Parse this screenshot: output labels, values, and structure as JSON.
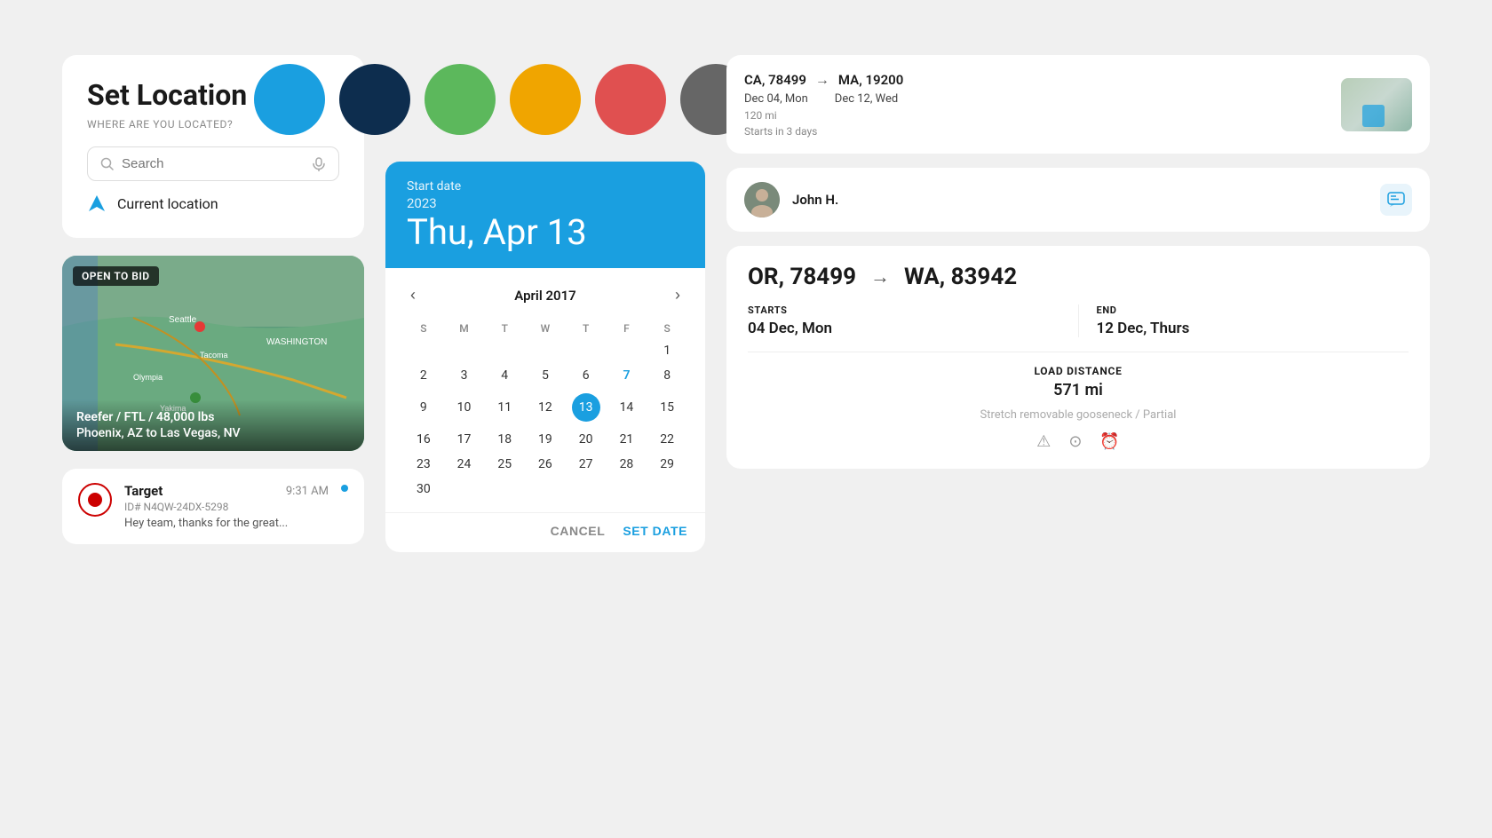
{
  "colors": {
    "blue": "#1a9fe0",
    "dark_navy": "#0d2d4e",
    "green": "#5cb85c",
    "yellow": "#f0a500",
    "red": "#e05050",
    "dark_gray": "#666666",
    "light_gray": "#c0c0c0"
  },
  "set_location": {
    "title": "Set Location",
    "subtitle": "WHERE ARE YOU LOCATED?",
    "search_placeholder": "Search",
    "current_location_label": "Current location"
  },
  "map_card": {
    "badge": "OPEN TO BID",
    "info_line1": "Reefer / FTL / 48,000 lbs",
    "info_line2": "Phoenix, AZ to Las Vegas, NV"
  },
  "notification": {
    "name": "Target",
    "id": "ID# N4QW-24DX-5298",
    "time": "9:31 AM",
    "message": "Hey team, thanks for the great..."
  },
  "calendar": {
    "start_label": "Start date",
    "year": "2023",
    "selected_date": "Thu, Apr 13",
    "month_label": "April 2017",
    "days_of_week": [
      "S",
      "M",
      "T",
      "W",
      "T",
      "F",
      "S"
    ],
    "weeks": [
      [
        "",
        "",
        "",
        "",
        "",
        "",
        "1"
      ],
      [
        "2",
        "3",
        "4",
        "5",
        "6",
        "7",
        "8"
      ],
      [
        "9",
        "10",
        "11",
        "12",
        "13",
        "14",
        "15"
      ],
      [
        "16",
        "17",
        "18",
        "19",
        "20",
        "21",
        "22"
      ],
      [
        "23",
        "24",
        "25",
        "26",
        "27",
        "28",
        "29"
      ],
      [
        "30",
        "",
        "",
        "",
        "",
        "",
        ""
      ]
    ],
    "today_day": "13",
    "highlight_day": "7",
    "cancel_label": "CANCEL",
    "set_date_label": "SET DATE"
  },
  "route_top": {
    "from": "CA, 78499",
    "to": "MA, 19200",
    "from_date": "Dec 04, Mon",
    "to_date": "Dec 12, Wed",
    "distance": "120 mi",
    "starts_in": "Starts in 3 days"
  },
  "user": {
    "name": "John H."
  },
  "route_large": {
    "from": "OR, 78499",
    "to": "WA, 83942",
    "starts_label": "STARTS",
    "starts_value": "04 Dec, Mon",
    "end_label": "END",
    "end_value": "12 Dec, Thurs",
    "distance_label": "LOAD DISTANCE",
    "distance_value": "571 mi",
    "truck_type": "Stretch removable gooseneck / Partial"
  },
  "swatches": [
    {
      "color": "#1a9fe0",
      "name": "blue"
    },
    {
      "color": "#0d2d4e",
      "name": "dark-navy"
    },
    {
      "color": "#5cb85c",
      "name": "green"
    },
    {
      "color": "#f0a500",
      "name": "yellow"
    },
    {
      "color": "#e05050",
      "name": "red"
    },
    {
      "color": "#666666",
      "name": "dark-gray"
    },
    {
      "color": "#c0c0c0",
      "name": "light-gray"
    }
  ]
}
